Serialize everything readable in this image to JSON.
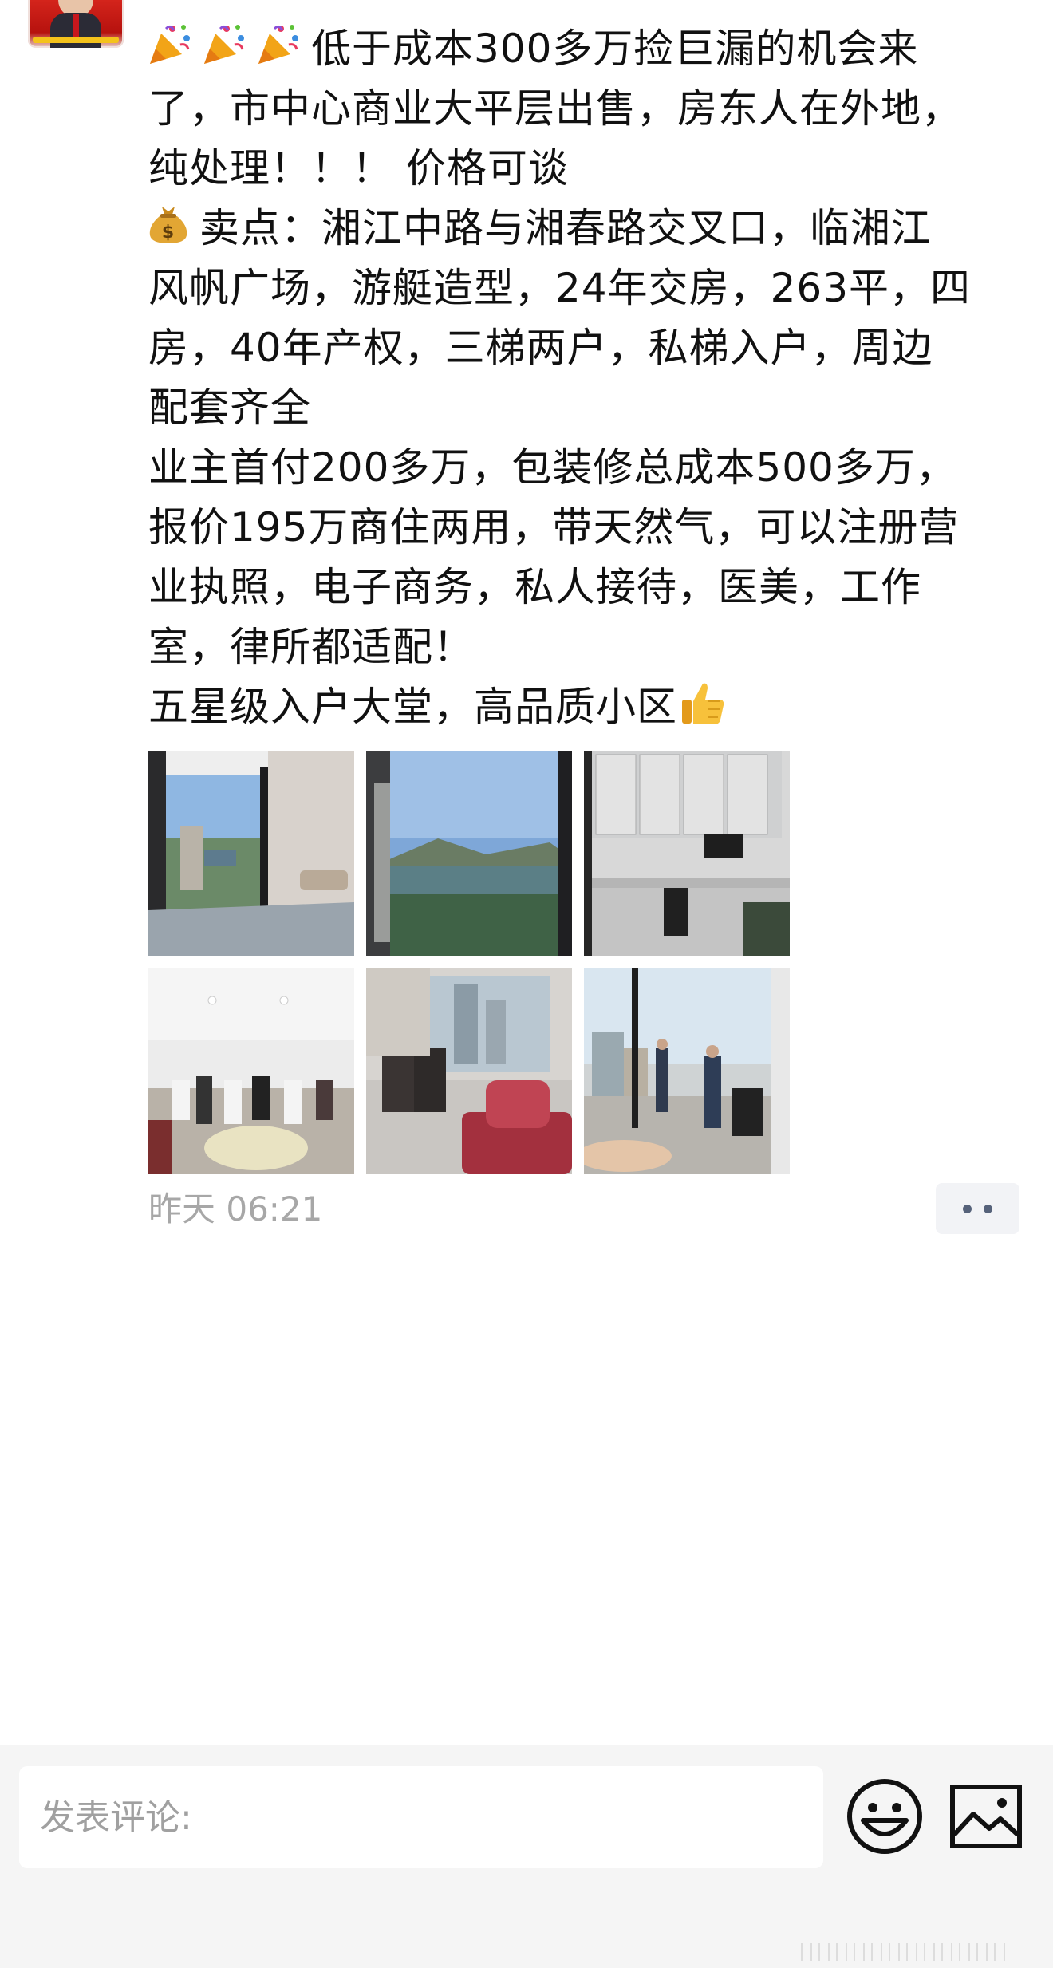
{
  "post": {
    "lines": [
      "低于成本300多万捡巨漏的机会来",
      "了，市中心商业大平层出售，房东人在外地，",
      "纯处理！！！ 价格可谈",
      "卖点：湘江中路与湘春路交叉口，临湘江",
      "风帆广场，游艇造型，24年交房，263平，四",
      "房，40年产权，三梯两户，私梯入户，周边",
      "配套齐全",
      "业主首付200多万，包装修总成本500多万，",
      "报价195万商住两用，带天然气，可以注册营",
      "业执照，电子商务，私人接待，医美，工作",
      "室，律所都适配！",
      "五星级入户大堂，高品质小区"
    ],
    "emojis": {
      "line1": "party-popper-icon",
      "line4": "money-bag-icon",
      "line12": "thumbs-up-icon"
    },
    "photos": [
      {
        "name": "photo-living-room-window-view"
      },
      {
        "name": "photo-river-view-from-window"
      },
      {
        "name": "photo-kitchen"
      },
      {
        "name": "photo-dining-room-crowd"
      },
      {
        "name": "photo-living-room-chairs"
      },
      {
        "name": "photo-balcony-window-view"
      }
    ],
    "timestamp": "昨天 06:21"
  },
  "comment_bar": {
    "placeholder": "发表评论:",
    "value": ""
  },
  "colors": {
    "text": "#111111",
    "timestamp": "#a7a7a7",
    "more_button_bg": "#f2f3f6",
    "more_dots": "#56627a",
    "comment_bar_bg": "#f5f5f5"
  }
}
